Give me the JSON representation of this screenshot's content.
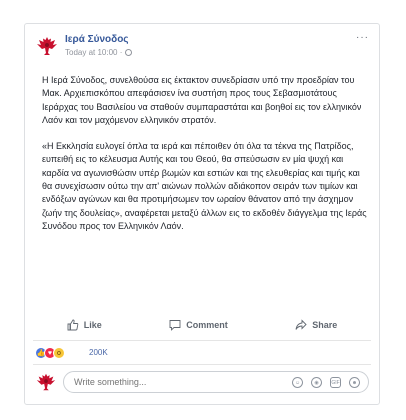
{
  "post": {
    "page_name": "Ιερά Σύνοδος",
    "timestamp": "Today at 10:00 ·",
    "paragraph_1": "Η Ιερά Σύνοδος, συνελθούσα εις έκτακτον συνεδρίασιν υπό την προεδρίαν του Μακ. Αρχιεπισκόπου απεφάσισεν ίνα συστήση προς τους Σεβασμιοτάτους Ιεράρχας του Βασιλείου να σταθούν συμπαραστάται και βοηθοί εις τον ελληνικόν Λαόν και τον μαχόμενον ελληνικόν στρατόν.",
    "paragraph_2": "«Η Εκκλησία ευλογεί όπλα τα ιερά και πέποιθεν ότι όλα τα τέκνα της Πατρίδος, ευπειθή εις το κέλευσμα Αυτής και του Θεού, θα σπεύσωσιν εν μία ψυχή και καρδία να αγωνισθώσιν υπέρ βωμών και εστιών και της ελευθερίας και τιμής και θα συνεχίσωσιν ούτω την απ' αιώνων πολλών αδιάκοπον σειράν των τιμίων και ενδόξων αγώνων και θα προτιμήσωμεν τον ωραίον θάνατον από την άσχημον ζωήν της δουλείας», αναφέρεται μεταξύ άλλων εις το εκδοθέν διάγγελμα της Ιεράς Συνόδου προς τον Ελληνικόν Λαόν."
  },
  "actions": {
    "like_label": "Like",
    "comment_label": "Comment",
    "share_label": "Share"
  },
  "reactions": {
    "count": "200K",
    "types": [
      "like",
      "love",
      "wow"
    ]
  },
  "comment": {
    "placeholder": "Write something..."
  },
  "colors": {
    "link_blue": "#365899",
    "meta_gray": "#90949c",
    "action_gray": "#606770",
    "emblem_red": "#c8102e"
  }
}
